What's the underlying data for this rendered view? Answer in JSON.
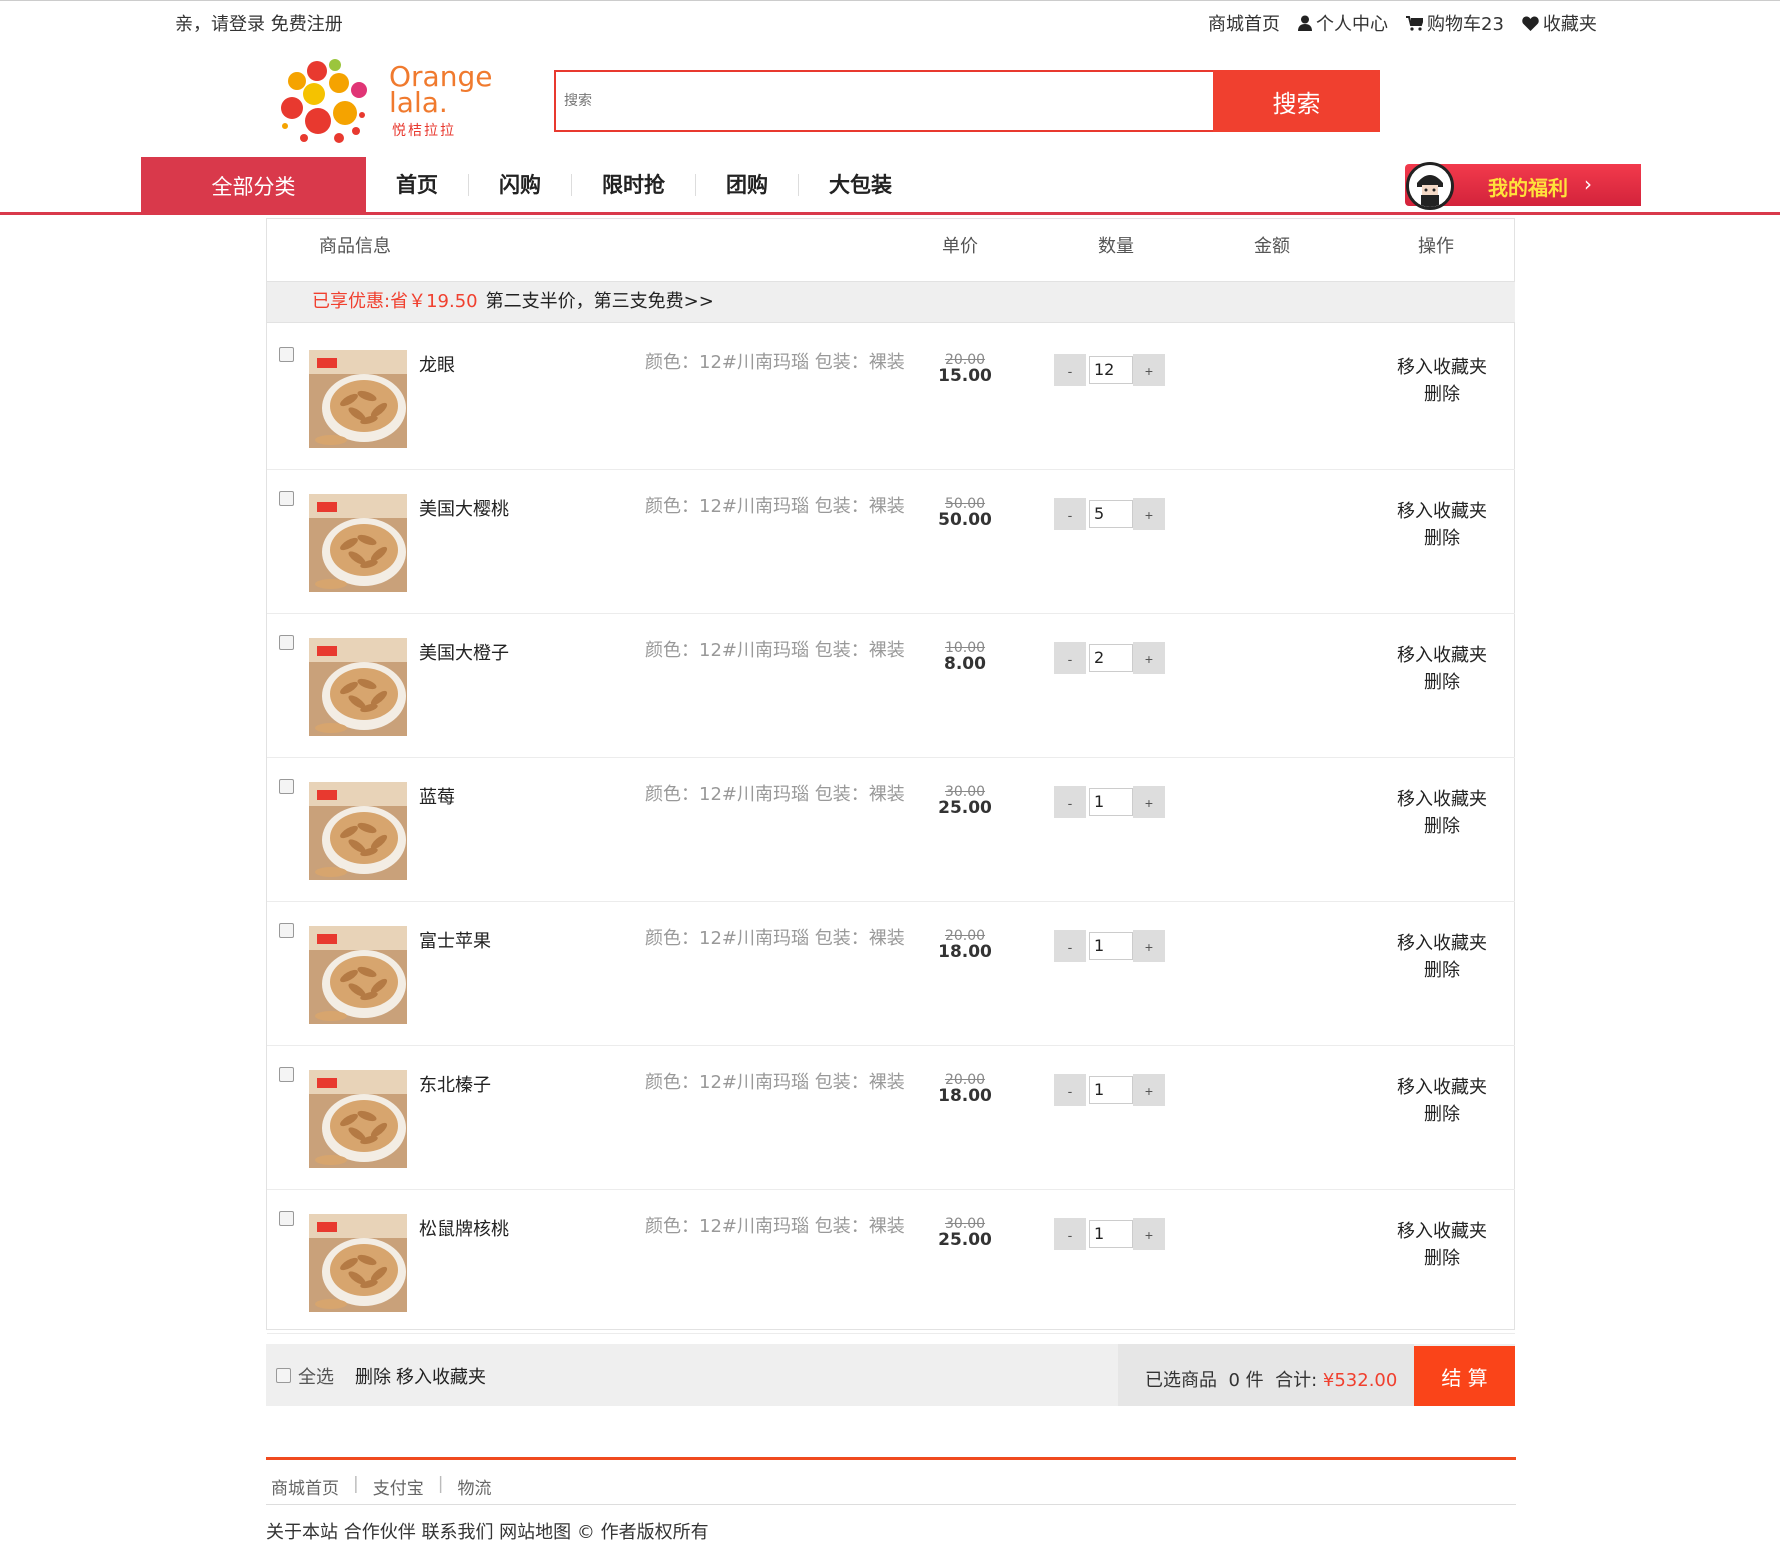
{
  "topbar": {
    "greeting": "亲，请登录 免费注册",
    "links": {
      "home": "商城首页",
      "user_center": "个人中心",
      "cart": "购物车23",
      "favorites": "收藏夹"
    }
  },
  "header": {
    "logo_text": "Orange lala.",
    "logo_subtext": "悦桔拉拉",
    "search": {
      "placeholder": "搜索",
      "button": "搜索"
    }
  },
  "nav": {
    "all_categories": "全部分类",
    "items": [
      "首页",
      "闪购",
      "限时抢",
      "团购",
      "大包装"
    ],
    "welfare": "我的福利",
    "welfare_arrow": "›"
  },
  "cart": {
    "columns": {
      "info": "商品信息",
      "price": "单价",
      "quantity": "数量",
      "amount": "金额",
      "action": "操作"
    },
    "promo": {
      "saved": "已享优惠:省￥19.50",
      "rule": "第二支半价，第三支免费>>"
    },
    "items": [
      {
        "name": "龙眼",
        "attr": "颜色：12#川南玛瑙 包装：裸装",
        "old_price": "20.00",
        "price": "15.00",
        "qty": "12",
        "fav": "移入收藏夹",
        "del": "删除"
      },
      {
        "name": "美国大樱桃",
        "attr": "颜色：12#川南玛瑙 包装：裸装",
        "old_price": "50.00",
        "price": "50.00",
        "qty": "5",
        "fav": "移入收藏夹",
        "del": "删除"
      },
      {
        "name": "美国大橙子",
        "attr": "颜色：12#川南玛瑙 包装：裸装",
        "old_price": "10.00",
        "price": "8.00",
        "qty": "2",
        "fav": "移入收藏夹",
        "del": "删除"
      },
      {
        "name": "蓝莓",
        "attr": "颜色：12#川南玛瑙 包装：裸装",
        "old_price": "30.00",
        "price": "25.00",
        "qty": "1",
        "fav": "移入收藏夹",
        "del": "删除"
      },
      {
        "name": "富士苹果",
        "attr": "颜色：12#川南玛瑙 包装：裸装",
        "old_price": "20.00",
        "price": "18.00",
        "qty": "1",
        "fav": "移入收藏夹",
        "del": "删除"
      },
      {
        "name": "东北榛子",
        "attr": "颜色：12#川南玛瑙 包装：裸装",
        "old_price": "20.00",
        "price": "18.00",
        "qty": "1",
        "fav": "移入收藏夹",
        "del": "删除"
      },
      {
        "name": "松鼠牌核桃",
        "attr": "颜色：12#川南玛瑙 包装：裸装",
        "old_price": "30.00",
        "price": "25.00",
        "qty": "1",
        "fav": "移入收藏夹",
        "del": "删除"
      }
    ],
    "qty_minus": "-",
    "qty_plus": "+",
    "bottom": {
      "select_all": "全选",
      "delete": "删除",
      "move_fav": "移入收藏夹",
      "selected_label": "已选商品",
      "selected_count": "0 件",
      "total_label": "合计:",
      "total_amount": "¥532.00",
      "checkout": "结 算"
    }
  },
  "footer": {
    "links": [
      "商城首页",
      "支付宝",
      "物流"
    ],
    "copyright": "关于本站 合作伙伴 联系我们 网站地图 © 作者版权所有"
  },
  "colors": {
    "accent": "#f0402f",
    "nav_red": "#d9394b",
    "checkout": "#fa4419",
    "welfare_text": "#ffe23b"
  }
}
